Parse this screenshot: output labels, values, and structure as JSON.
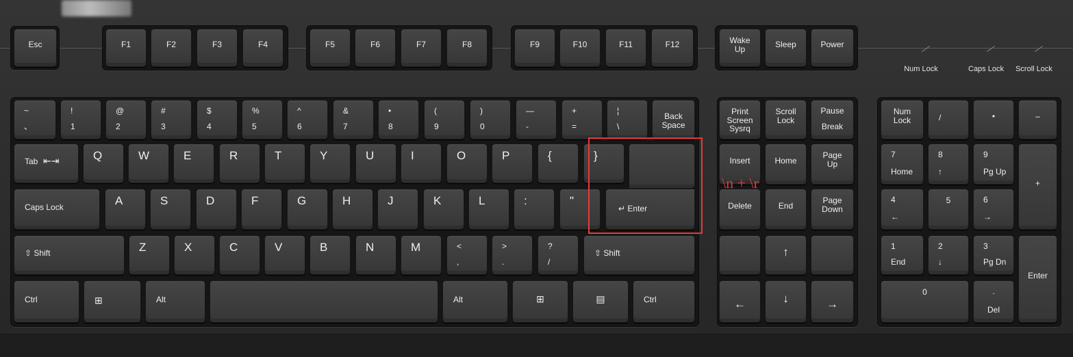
{
  "keys": {
    "esc": "Esc",
    "f1": "F1",
    "f2": "F2",
    "f3": "F3",
    "f4": "F4",
    "f5": "F5",
    "f6": "F6",
    "f7": "F7",
    "f8": "F8",
    "f9": "F9",
    "f10": "F10",
    "f11": "F11",
    "f12": "F12",
    "wakeup": "Wake\nUp",
    "sleep": "Sleep",
    "power": "Power",
    "grave": {
      "top": "~",
      "bottom": "、"
    },
    "d1": {
      "top": "!",
      "bottom": "1"
    },
    "d2": {
      "top": "@",
      "bottom": "2"
    },
    "d3": {
      "top": "#",
      "bottom": "3"
    },
    "d4": {
      "top": "$",
      "bottom": "4"
    },
    "d5": {
      "top": "%",
      "bottom": "5"
    },
    "d6": {
      "top": "^",
      "bottom": "6"
    },
    "d7": {
      "top": "&",
      "bottom": "7"
    },
    "d8": {
      "top": "•",
      "bottom": "8"
    },
    "d9": {
      "top": "(",
      "bottom": "9"
    },
    "d0": {
      "top": ")",
      "bottom": "0"
    },
    "minus": {
      "top": "—",
      "bottom": "-"
    },
    "equal": {
      "top": "+",
      "bottom": "="
    },
    "pipe": {
      "top": "¦",
      "bottom": "\\"
    },
    "backspace": "Back\nSpace",
    "tab": "Tab",
    "tab_arrows": "⇤⇥",
    "q": "Q",
    "w": "W",
    "e": "E",
    "r": "R",
    "t": "T",
    "y": "Y",
    "u": "U",
    "i": "I",
    "o": "O",
    "p": "P",
    "lbrace": "{",
    "rbrace": "}",
    "capslock": "Caps Lock",
    "a": "A",
    "s": "S",
    "d": "D",
    "f": "F",
    "g": "G",
    "h": "H",
    "j": "J",
    "k": "K",
    "l": "L",
    "colon": ":",
    "quote": "\"",
    "enter": "↵ Enter",
    "lshift": "⇧ Shift",
    "z": "Z",
    "x": "X",
    "c": "C",
    "v": "V",
    "b": "B",
    "n": "N",
    "m": "M",
    "comma": {
      "top": "<",
      "bottom": ","
    },
    "period": {
      "top": ">",
      "bottom": "."
    },
    "slash": {
      "top": "?",
      "bottom": "/"
    },
    "rshift": "⇧ Shift",
    "lctrl": "Ctrl",
    "lwin": "⊞",
    "lalt": "Alt",
    "ralt": "Alt",
    "rwin": "⊞",
    "menu": "▤",
    "rctrl": "Ctrl",
    "printscreen": "Print\nScreen\nSysrq",
    "scrolllock": "Scroll\nLock",
    "pause": {
      "top": "Pause",
      "bottom": "Break"
    },
    "insert": "Insert",
    "home": "Home",
    "pageup": "Page\nUp",
    "delete": "Delete",
    "end": "End",
    "pagedown": "Page\nDown",
    "up": "↑",
    "left": "←",
    "down": "↓",
    "right": "→",
    "numlock": "Num\nLock",
    "ndiv": "/",
    "nmul": "•",
    "nminus": "–",
    "n7": {
      "top": "7",
      "bottom": "Home"
    },
    "n8": {
      "top": "8",
      "bottom": "↑"
    },
    "n9": {
      "top": "9",
      "bottom": "Pg Up"
    },
    "nplus": "+",
    "n4": {
      "top": "4",
      "bottom": "←"
    },
    "n5": "5",
    "n6": {
      "top": "6",
      "bottom": "→"
    },
    "n1": {
      "top": "1",
      "bottom": "End"
    },
    "n2": {
      "top": "2",
      "bottom": "↓"
    },
    "n3": {
      "top": "3",
      "bottom": "Pg Dn"
    },
    "nenter": "Enter",
    "n0": "0",
    "ndel": {
      "top": ".",
      "bottom": "Del"
    }
  },
  "indicators": [
    "Num Lock",
    "Caps Lock",
    "Scroll Lock"
  ],
  "annotation": "\\n + \\r",
  "colors": {
    "highlight": "#e8393b",
    "key": "#3f3f3f",
    "keyboard": "#2f2f2f"
  }
}
